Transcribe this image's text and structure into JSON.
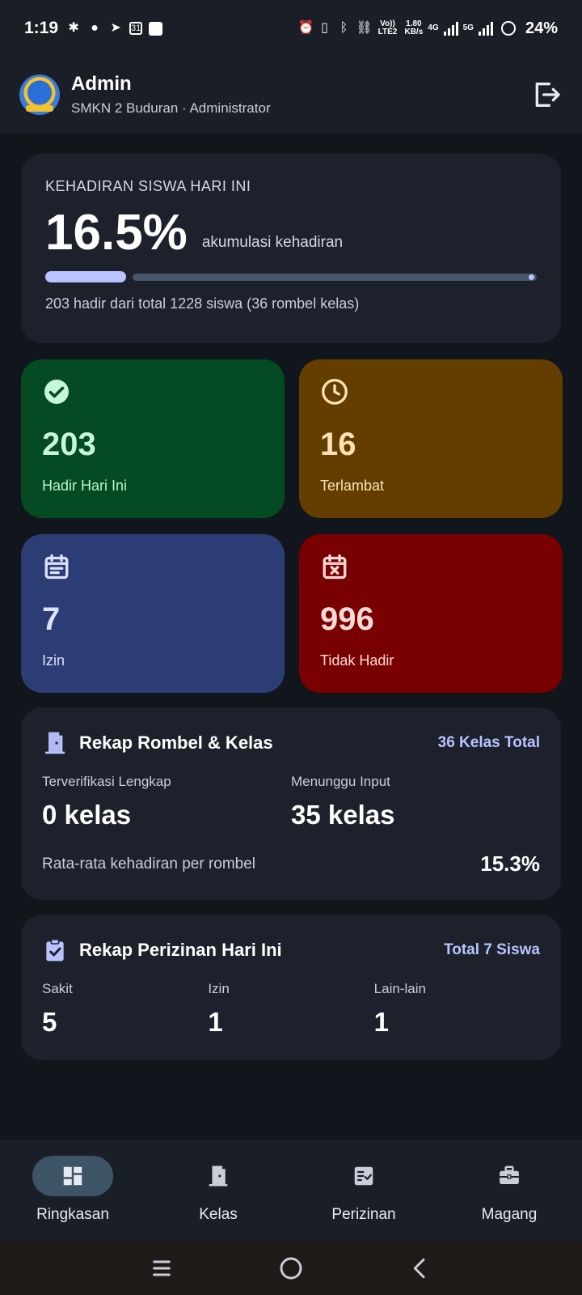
{
  "status_bar": {
    "time": "1:19",
    "net_speed_value": "1.80",
    "net_speed_unit": "KB/s",
    "lte_label": "Vo)) LTE2",
    "net4g": "4G",
    "net5g": "5G",
    "battery": "24%"
  },
  "app_bar": {
    "title": "Admin",
    "subtitle": "SMKN 2 Buduran · Administrator"
  },
  "summary": {
    "label": "KEHADIRAN SISWA HARI INI",
    "percent": "16.5%",
    "percent_value": 16.5,
    "caption": "akumulasi kehadiran",
    "footer": "203 hadir dari total 1228 siswa (36 rombel kelas)"
  },
  "stats": {
    "hadir": {
      "value": "203",
      "label": "Hadir Hari Ini",
      "icon": "check-circle-icon"
    },
    "terlambat": {
      "value": "16",
      "label": "Terlambat",
      "icon": "clock-icon"
    },
    "izin": {
      "value": "7",
      "label": "Izin",
      "icon": "calendar-note-icon"
    },
    "tidak_hadir": {
      "value": "996",
      "label": "Tidak Hadir",
      "icon": "calendar-x-icon"
    }
  },
  "rombel": {
    "title": "Rekap Rombel & Kelas",
    "total": "36 Kelas Total",
    "verified_label": "Terverifikasi Lengkap",
    "verified_value": "0 kelas",
    "pending_label": "Menunggu Input",
    "pending_value": "35 kelas",
    "avg_label": "Rata-rata kehadiran per rombel",
    "avg_value": "15.3%"
  },
  "perizinan": {
    "title": "Rekap Perizinan Hari Ini",
    "total": "Total 7 Siswa",
    "items": [
      {
        "label": "Sakit",
        "value": "5"
      },
      {
        "label": "Izin",
        "value": "1"
      },
      {
        "label": "Lain-lain",
        "value": "1"
      }
    ]
  },
  "nav": {
    "items": [
      {
        "label": "Ringkasan",
        "icon": "dashboard-icon",
        "active": true
      },
      {
        "label": "Kelas",
        "icon": "door-icon",
        "active": false
      },
      {
        "label": "Perizinan",
        "icon": "checklist-icon",
        "active": false
      },
      {
        "label": "Magang",
        "icon": "briefcase-icon",
        "active": false
      }
    ]
  },
  "colors": {
    "accent": "#b9c3ff",
    "hadir": "#044a22",
    "terlambat": "#633e00",
    "izin": "#2c3d75",
    "tidak_hadir": "#780000"
  }
}
